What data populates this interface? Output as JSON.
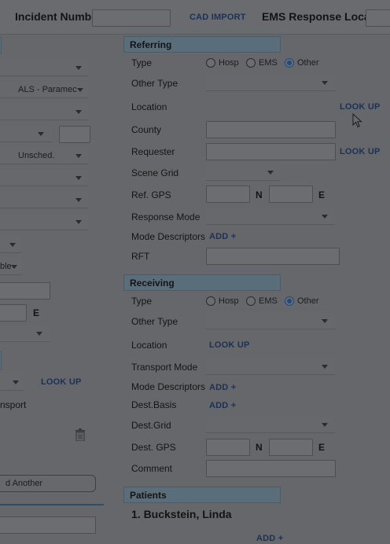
{
  "header": {
    "incident_number_label": "Incident Number",
    "cad_import_label": "CAD IMPORT",
    "ems_response_label": "EMS Response Local #"
  },
  "left_column": {
    "level_value": "ALS - Paramec",
    "priority_value": "Unsched.",
    "partial_value": "ble",
    "e_label": "E",
    "look_up_label": "LOOK UP",
    "transport_text": "nsport",
    "add_another_label": "d Another",
    "trash_icon": "trash-icon"
  },
  "referring": {
    "heading": "Referring",
    "type_label": "Type",
    "type_options": [
      "Hosp",
      "EMS",
      "Other"
    ],
    "type_selected": "Other",
    "other_type_label": "Other Type",
    "location_label": "Location",
    "location_lookup": "LOOK UP",
    "county_label": "County",
    "requester_label": "Requester",
    "requester_lookup": "LOOK UP",
    "scene_grid_label": "Scene Grid",
    "ref_gps_label": "Ref. GPS",
    "gps_n": "N",
    "gps_e": "E",
    "response_mode_label": "Response Mode",
    "mode_descriptors_label": "Mode Descriptors",
    "mode_add": "ADD +",
    "rft_label": "RFT"
  },
  "receiving": {
    "heading": "Receiving",
    "type_label": "Type",
    "type_options": [
      "Hosp",
      "EMS",
      "Other"
    ],
    "type_selected": "Other",
    "other_type_label": "Other Type",
    "location_label": "Location",
    "location_lookup": "LOOK UP",
    "transport_mode_label": "Transport Mode",
    "mode_descriptors_label": "Mode Descriptors",
    "mode_add": "ADD +",
    "dest_basis_label": "Dest.Basis",
    "dest_basis_add": "ADD +",
    "dest_grid_label": "Dest.Grid",
    "dest_gps_label": "Dest. GPS",
    "gps_n": "N",
    "gps_e": "E",
    "comment_label": "Comment"
  },
  "patients": {
    "heading": "Patients",
    "items": [
      "1. Buckstein, Linda"
    ],
    "add_label": "ADD +"
  },
  "colors": {
    "overlay_background": "#66676a",
    "section_header": "#5a6d7a",
    "link": "#1b3157",
    "radio_selected": "#1d4a85"
  }
}
